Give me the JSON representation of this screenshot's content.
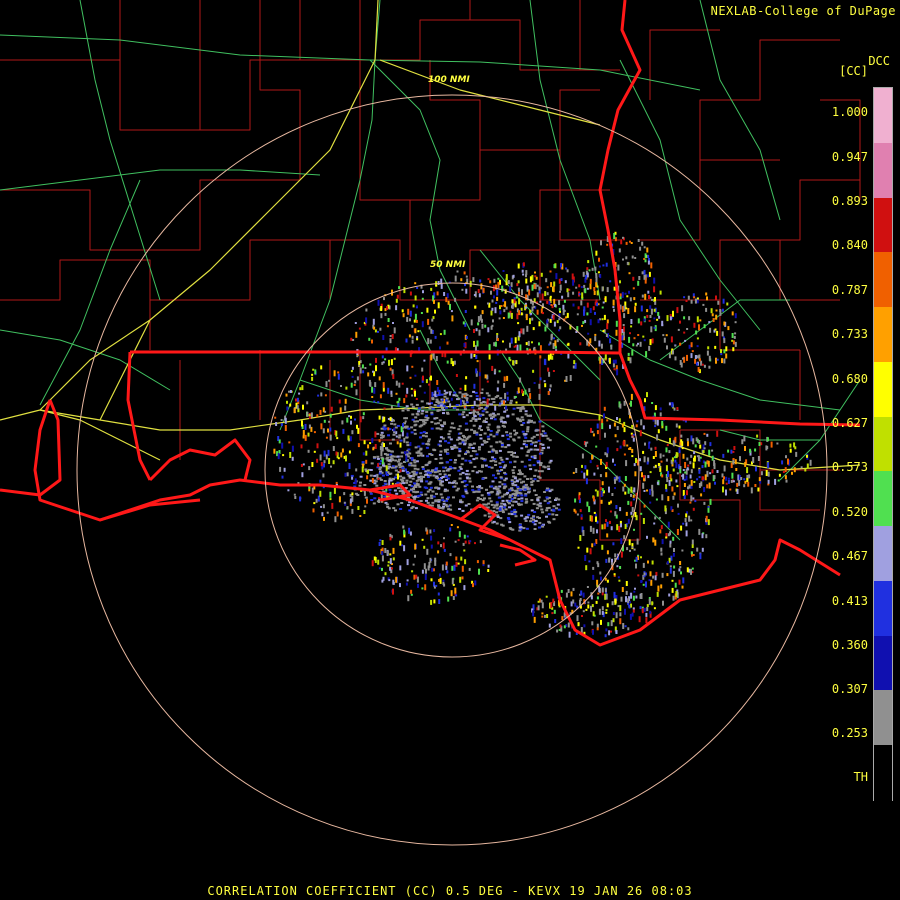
{
  "credit": "NEXLAB-College of DuPage",
  "product_code": "DCC",
  "unit": "[CC]",
  "footer": "CORRELATION COEFFICIENT (CC) 0.5 DEG - KEVX 19 JAN 26 08:03",
  "range_rings": [
    {
      "label": "50 NMI"
    },
    {
      "label": "100 NMI"
    }
  ],
  "legend": {
    "ticks": [
      "1.000",
      "0.947",
      "0.893",
      "0.840",
      "0.787",
      "0.733",
      "0.680",
      "0.627",
      "0.573",
      "0.520",
      "0.467",
      "0.413",
      "0.360",
      "0.307",
      "0.253",
      "TH"
    ],
    "colors": [
      "#f0b0d0",
      "#e080b0",
      "#d01010",
      "#f06000",
      "#ffa000",
      "#ffff00",
      "#c0e000",
      "#50e050",
      "#a0a0e0",
      "#2030e0",
      "#1010b0",
      "#909090",
      "#000000"
    ]
  },
  "colors": {
    "state_border": "#ff1818",
    "county_border": "#b01818",
    "highway": "#e0e040",
    "road": "#40c060",
    "ring": "#e8b8a0",
    "label": "#ffff40"
  }
}
